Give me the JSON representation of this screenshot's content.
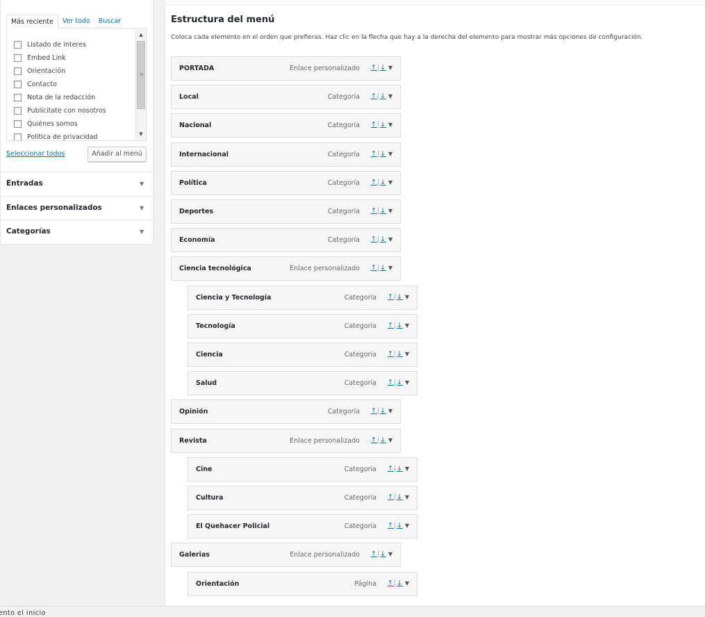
{
  "sidebar": {
    "tabs": [
      "Más reciente",
      "Ver todo",
      "Buscar"
    ],
    "pages": [
      "Listado de interes",
      "Embed Link",
      "Orientación",
      "Contacto",
      "Nota de la redacción",
      "Publicitate con nosotros",
      "Quiénes somos",
      "Política de privacidad"
    ],
    "select_all": "Seleccionar todos",
    "add_button": "Añadir al menú",
    "sections": [
      "Entradas",
      "Enlaces personalizados",
      "Categorías"
    ]
  },
  "main": {
    "title": "Estructura del menú",
    "description": "Coloca cada elemento en el orden que prefieras. Haz clic en la flecha que hay a la derecha del elemento para mostrar más opciones de configuración.",
    "items": [
      {
        "title": "PORTADA",
        "type": "Enlace personalizado",
        "depth": 0
      },
      {
        "title": "Local",
        "type": "Categoría",
        "depth": 0
      },
      {
        "title": "Nacional",
        "type": "Categoría",
        "depth": 0
      },
      {
        "title": "Internacional",
        "type": "Categoría",
        "depth": 0
      },
      {
        "title": "Política",
        "type": "Categoría",
        "depth": 0
      },
      {
        "title": "Deportes",
        "type": "Categoría",
        "depth": 0
      },
      {
        "title": "Economía",
        "type": "Categoría",
        "depth": 0
      },
      {
        "title": "Ciencia tecnológica",
        "type": "Enlace personalizado",
        "depth": 0
      },
      {
        "title": "Ciencia y Tecnología",
        "type": "Categoría",
        "depth": 1
      },
      {
        "title": "Tecnología",
        "type": "Categoría",
        "depth": 1
      },
      {
        "title": "Ciencia",
        "type": "Categoría",
        "depth": 1
      },
      {
        "title": "Salud",
        "type": "Categoría",
        "depth": 1
      },
      {
        "title": "Opinión",
        "type": "Categoría",
        "depth": 0
      },
      {
        "title": "Revista",
        "type": "Enlace personalizado",
        "depth": 0
      },
      {
        "title": "Cine",
        "type": "Categoría",
        "depth": 1
      },
      {
        "title": "Cultura",
        "type": "Categoría",
        "depth": 1
      },
      {
        "title": "El Quehacer Policial",
        "type": "Categoría",
        "depth": 1
      },
      {
        "title": "Galerias",
        "type": "Enlace personalizado",
        "depth": 0
      },
      {
        "title": "Orientación",
        "type": "Página",
        "depth": 1
      }
    ],
    "move_up": "↑",
    "move_sep": "|",
    "move_down": "↓"
  },
  "footer": {
    "text": "ento  el  inicio"
  },
  "colors": {
    "link": "#0073aa",
    "item_bg": "#f6f6f6",
    "item_border": "#dcdcdc"
  }
}
